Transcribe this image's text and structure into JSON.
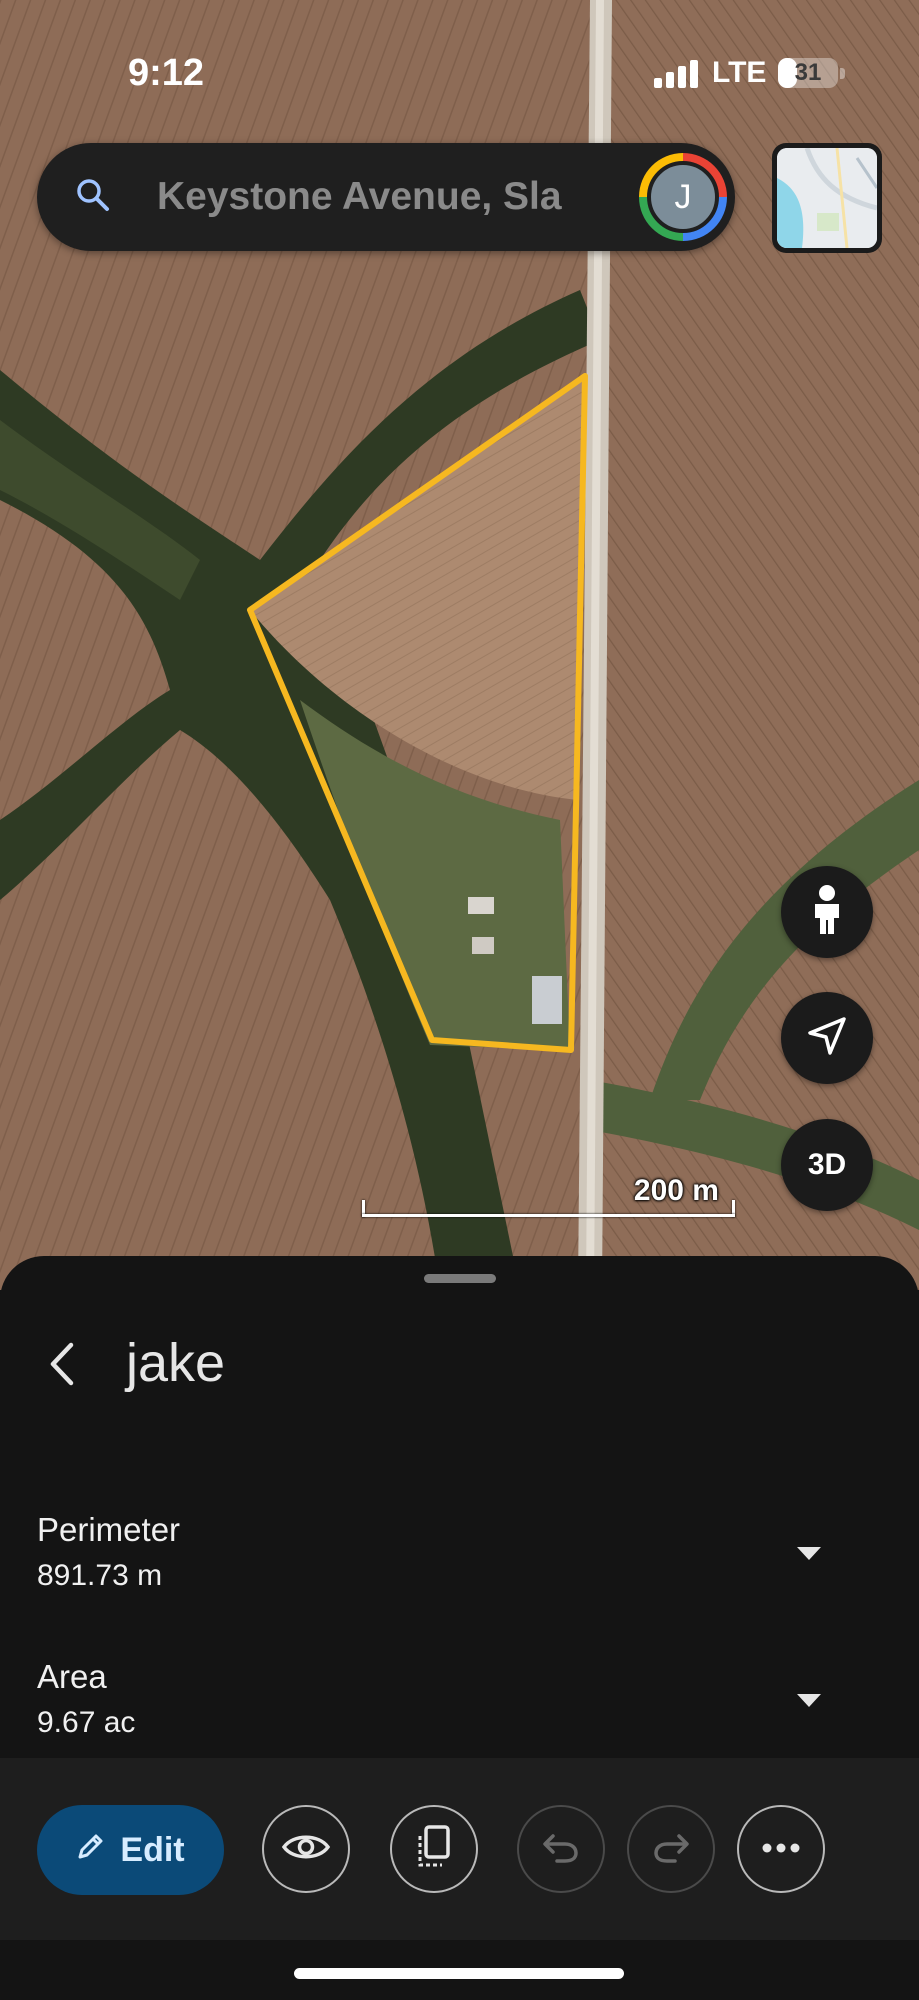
{
  "status_bar": {
    "time": "9:12",
    "network": "LTE",
    "battery_percent": 31,
    "battery_label": "31",
    "icons": [
      "signal-bars-icon",
      "battery-icon"
    ]
  },
  "search": {
    "value": "Keystone Avenue, Sla",
    "icon": "search-icon",
    "avatar_initial": "J"
  },
  "map": {
    "layer_thumbnail_icon": "map-layer-icon",
    "scale_label": "200 m",
    "polygon_color": "#f6b820",
    "controls": [
      {
        "name": "street-view-icon"
      },
      {
        "name": "navigation-arrow-icon"
      },
      {
        "label": "3D"
      }
    ]
  },
  "sheet": {
    "title": "jake",
    "back_icon": "chevron-left-icon",
    "metrics": [
      {
        "label": "Perimeter",
        "value": "891.73 m"
      },
      {
        "label": "Area",
        "value": "9.67 ac"
      }
    ]
  },
  "toolbar": {
    "edit_label": "Edit",
    "edit_icon": "pencil-icon",
    "accent": "#0b4a78",
    "buttons": [
      "eye-icon",
      "copy-icon",
      "undo-icon",
      "redo-icon",
      "more-icon"
    ]
  }
}
